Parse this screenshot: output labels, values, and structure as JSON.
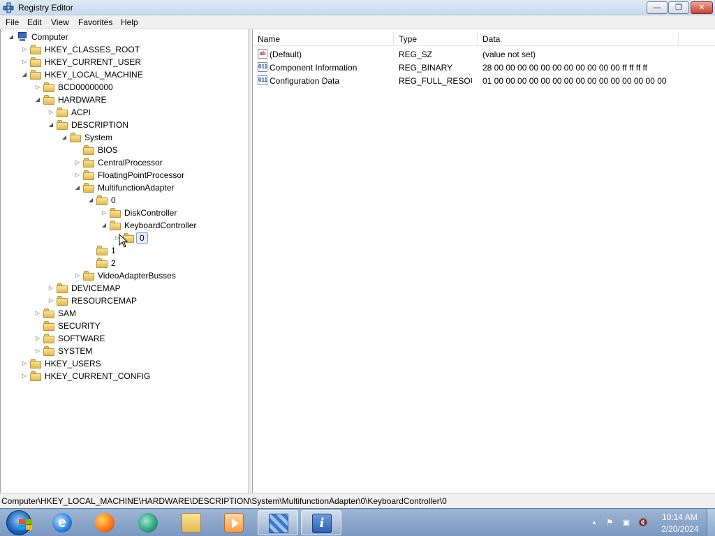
{
  "window": {
    "title": "Registry Editor",
    "minimize_label": "—",
    "maximize_label": "❐",
    "close_label": "✕"
  },
  "menu": [
    "File",
    "Edit",
    "View",
    "Favorites",
    "Help"
  ],
  "tree": {
    "nodes": [
      {
        "label": "Computer",
        "expander": "◢"
      },
      {
        "label": "HKEY_CLASSES_ROOT",
        "expander": "▷"
      },
      {
        "label": "HKEY_CURRENT_USER",
        "expander": "▷"
      },
      {
        "label": "HKEY_LOCAL_MACHINE",
        "expander": "◢"
      },
      {
        "label": "BCD00000000",
        "expander": "▷"
      },
      {
        "label": "HARDWARE",
        "expander": "◢"
      },
      {
        "label": "ACPI",
        "expander": "▷"
      },
      {
        "label": "DESCRIPTION",
        "expander": "◢"
      },
      {
        "label": "System",
        "expander": "◢"
      },
      {
        "label": "BIOS",
        "expander": ""
      },
      {
        "label": "CentralProcessor",
        "expander": "▷"
      },
      {
        "label": "FloatingPointProcessor",
        "expander": "▷"
      },
      {
        "label": "MultifunctionAdapter",
        "expander": "◢"
      },
      {
        "label": "0",
        "expander": "◢"
      },
      {
        "label": "DiskController",
        "expander": "▷"
      },
      {
        "label": "KeyboardController",
        "expander": "◢"
      },
      {
        "label": "0",
        "expander": "▷"
      },
      {
        "label": "1",
        "expander": ""
      },
      {
        "label": "2",
        "expander": ""
      },
      {
        "label": "VideoAdapterBusses",
        "expander": "▷"
      },
      {
        "label": "DEVICEMAP",
        "expander": "▷"
      },
      {
        "label": "RESOURCEMAP",
        "expander": "▷"
      },
      {
        "label": "SAM",
        "expander": "▷"
      },
      {
        "label": "SECURITY",
        "expander": ""
      },
      {
        "label": "SOFTWARE",
        "expander": "▷"
      },
      {
        "label": "SYSTEM",
        "expander": "▷"
      },
      {
        "label": "HKEY_USERS",
        "expander": "▷"
      },
      {
        "label": "HKEY_CURRENT_CONFIG",
        "expander": "▷"
      }
    ]
  },
  "list": {
    "columns": [
      "Name",
      "Type",
      "Data"
    ],
    "rows": [
      {
        "icon": "ab",
        "name": "(Default)",
        "type": "REG_SZ",
        "data": "(value not set)"
      },
      {
        "icon": "011",
        "name": "Component Information",
        "type": "REG_BINARY",
        "data": "28 00 00 00 00 00 00 00 00 00 00 00 ff ff ff ff"
      },
      {
        "icon": "011",
        "name": "Configuration Data",
        "type": "REG_FULL_RESOU...",
        "data": "01 00 00 00 00 00 00 00 00 00 00 00 00 00 00 00"
      }
    ]
  },
  "status": {
    "path": "Computer\\HKEY_LOCAL_MACHINE\\HARDWARE\\DESCRIPTION\\System\\MultifunctionAdapter\\0\\KeyboardController\\0"
  },
  "taskbar": {
    "ie_glyph": "e",
    "info_glyph": "i",
    "clock_time": "10:14 AM",
    "clock_date": "2/20/2024",
    "tray_glyphs": {
      "arrow": "▲",
      "flag": "⚑",
      "network": "▣",
      "volume": "🔇"
    }
  }
}
